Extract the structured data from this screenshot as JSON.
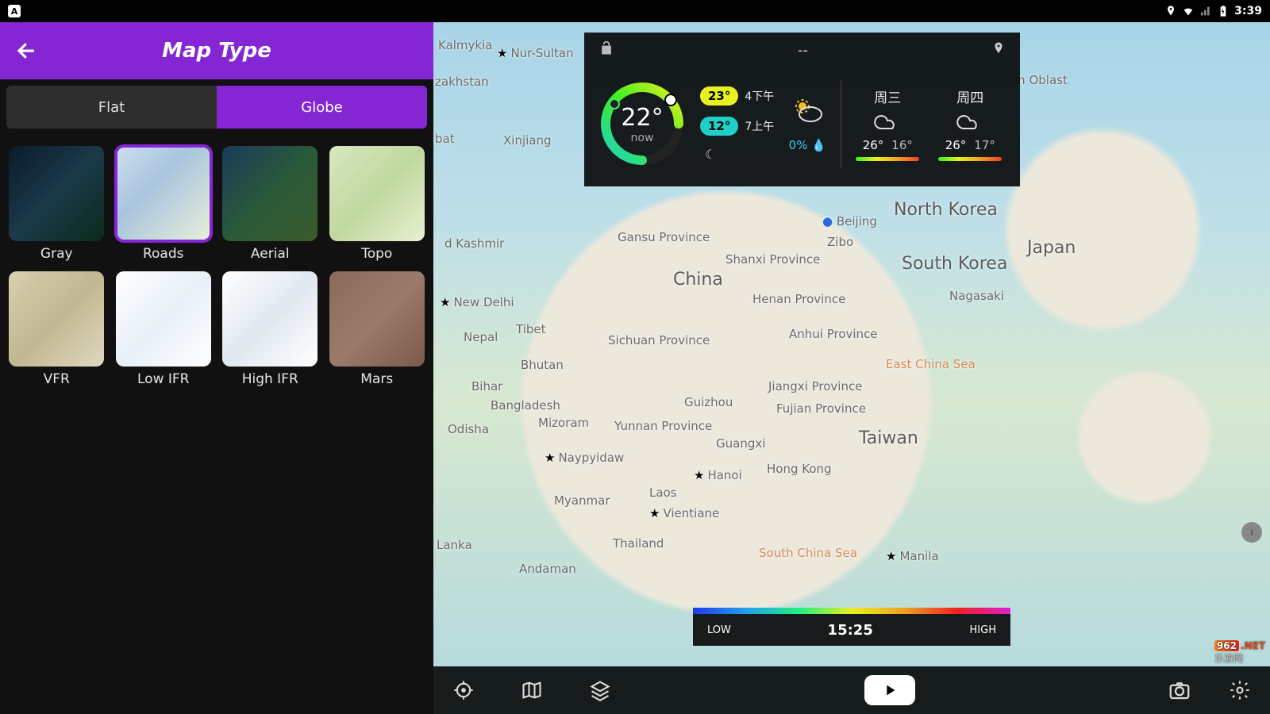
{
  "statusbar": {
    "time": "3:39",
    "left_badge": "A"
  },
  "panel": {
    "title": "Map Type",
    "tabs": {
      "flat": "Flat",
      "globe": "Globe",
      "active": "globe"
    },
    "types": [
      {
        "key": "gray",
        "label": "Gray"
      },
      {
        "key": "roads",
        "label": "Roads",
        "selected": true
      },
      {
        "key": "aerial",
        "label": "Aerial"
      },
      {
        "key": "topo",
        "label": "Topo"
      },
      {
        "key": "vfr",
        "label": "VFR"
      },
      {
        "key": "lowifr",
        "label": "Low IFR"
      },
      {
        "key": "highifr",
        "label": "High IFR"
      },
      {
        "key": "mars",
        "label": "Mars"
      }
    ]
  },
  "weather": {
    "location_placeholder": "--",
    "temp_now": "22°",
    "now_label": "now",
    "hi": {
      "temp": "23°",
      "time": "4下午"
    },
    "lo": {
      "temp": "12°",
      "time": "7上午"
    },
    "precip": "0%",
    "days": [
      {
        "name": "周三",
        "hi": "26°",
        "lo": "16°"
      },
      {
        "name": "周四",
        "hi": "26°",
        "lo": "17°"
      }
    ]
  },
  "timeline": {
    "low": "LOW",
    "high": "HIGH",
    "time": "15:25"
  },
  "map_labels": {
    "nur_sultan": "Nur-Sultan",
    "kalmykia": "Kalmykia",
    "kazakhstan": "zakhstan",
    "xinjiang": "Xinjiang",
    "gansu": "Gansu Province",
    "shanxi": "Shanxi Province",
    "china": "China",
    "henan": "Henan Province",
    "kashmir": "d Kashmir",
    "tibet": "Tibet",
    "nepal": "Nepal",
    "new_delhi": "New Delhi",
    "sichuan": "Sichuan Province",
    "bhutan": "Bhutan",
    "anhui": "Anhui Province",
    "bihar": "Bihar",
    "bangladesh": "Bangladesh",
    "mizoram": "Mizoram",
    "guizhou": "Guizhou",
    "jiangxi": "Jiangxi Province",
    "fujian": "Fujian Province",
    "yunnan": "Yunnan Province",
    "odisha": "Odisha",
    "guangxi": "Guangxi",
    "naypyidaw": "Naypyidaw",
    "myanmar": "Myanmar",
    "laos": "Laos",
    "hongkong": "Hong Kong",
    "taiwan": "Taiwan",
    "hanoi": "Hanoi",
    "vientiane": "Vientiane",
    "thailand": "Thailand",
    "lanka": "Lanka",
    "andaman": "Andaman",
    "beijing": "Beijing",
    "zibo": "Zibo",
    "north_korea": "North Korea",
    "south_korea": "South Korea",
    "nagasaki": "Nagasaki",
    "japan": "Japan",
    "oblast": "in Oblast",
    "east_china_sea": "East China Sea",
    "south_china_sea": "South China Sea",
    "manila": "Manila",
    "bat": "bat"
  },
  "watermark": {
    "num": "962",
    "dot": ".NET",
    "sub": "乐游网"
  }
}
